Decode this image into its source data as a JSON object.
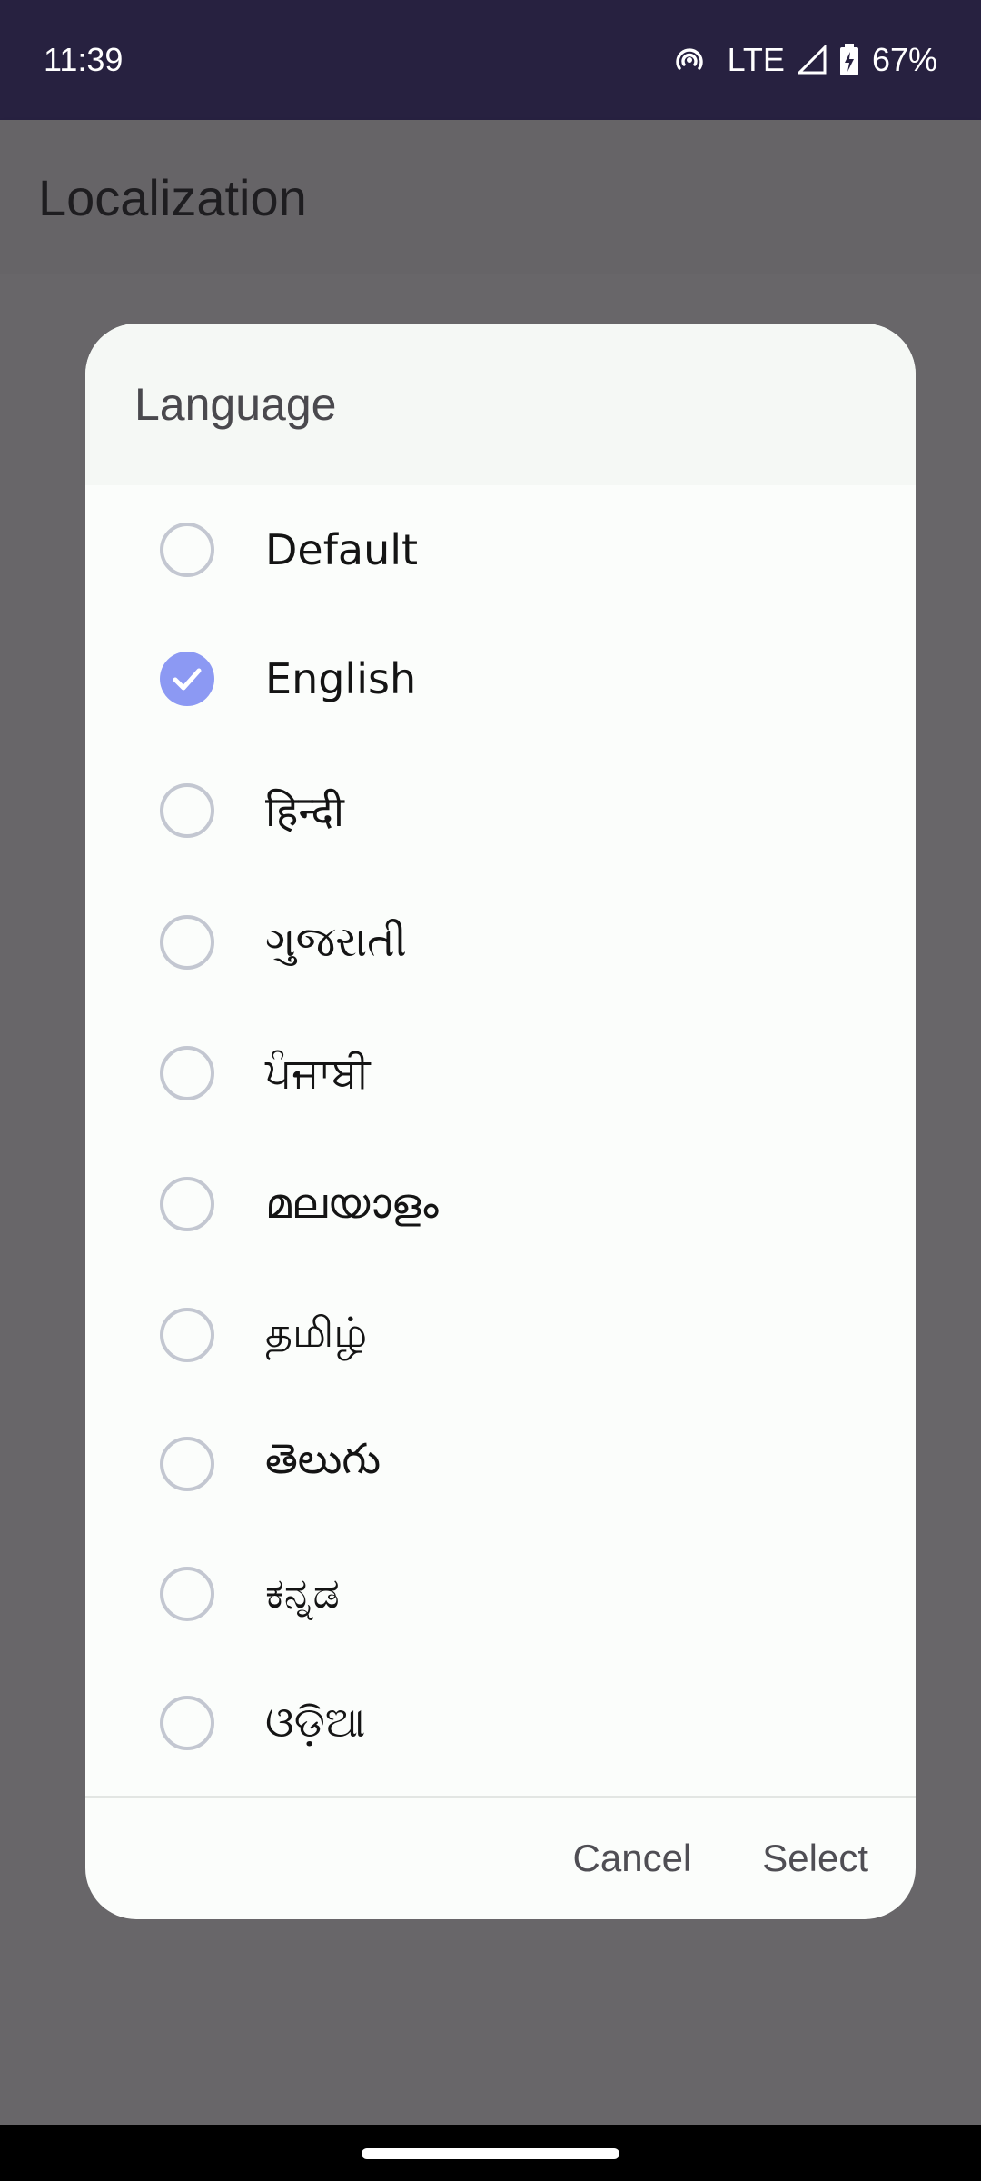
{
  "status_bar": {
    "time": "11:39",
    "network": "LTE",
    "battery": "67%",
    "icons": [
      "hotspot-icon",
      "signal-icon",
      "battery-charging-icon"
    ]
  },
  "app_bar": {
    "title": "Localization"
  },
  "dialog": {
    "title": "Language",
    "options": [
      {
        "label": "Default",
        "selected": false
      },
      {
        "label": "English",
        "selected": true
      },
      {
        "label": "हिन्दी",
        "selected": false
      },
      {
        "label": "ગુજરાતી",
        "selected": false
      },
      {
        "label": "ਪੰਜਾਬੀ",
        "selected": false
      },
      {
        "label": "മലയാളം",
        "selected": false
      },
      {
        "label": "தமிழ்",
        "selected": false
      },
      {
        "label": "తెలుగు",
        "selected": false
      },
      {
        "label": "ಕನ್ನಡ",
        "selected": false
      },
      {
        "label": "ଓଡ଼ିଆ",
        "selected": false
      }
    ],
    "cancel_label": "Cancel",
    "select_label": "Select"
  },
  "colors": {
    "status_bar_bg": "#272140",
    "scrim": "#686669",
    "radio_selected": "#8c99f3",
    "radio_unselected": "#c3c7d1"
  }
}
